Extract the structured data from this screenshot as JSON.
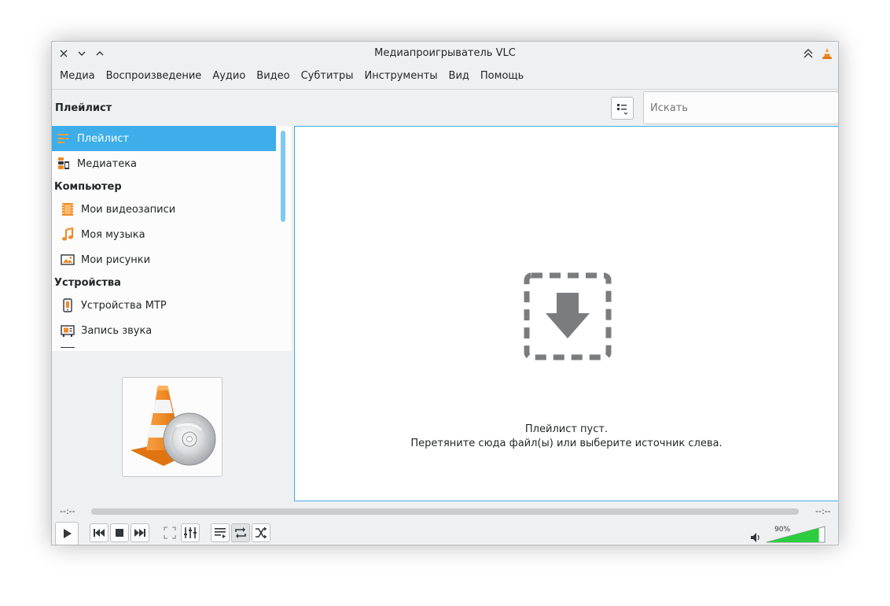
{
  "window": {
    "title": "Медиапроигрыватель VLC"
  },
  "menu": {
    "items": [
      "Медиа",
      "Воспроизведение",
      "Аудио",
      "Видео",
      "Субтитры",
      "Инструменты",
      "Вид",
      "Помощь"
    ]
  },
  "playlist_panel": {
    "header": "Плейлист",
    "search_placeholder": "Искать"
  },
  "sidebar": {
    "items": [
      {
        "label": "Плейлист",
        "icon": "playlist-icon",
        "selected": true
      },
      {
        "label": "Медиатека",
        "icon": "media-library-icon",
        "selected": false
      }
    ],
    "sections": [
      {
        "title": "Компьютер",
        "items": [
          {
            "label": "Мои видеозаписи",
            "icon": "film-icon"
          },
          {
            "label": "Моя музыка",
            "icon": "music-note-icon"
          },
          {
            "label": "Мои рисунки",
            "icon": "picture-icon"
          }
        ]
      },
      {
        "title": "Устройства",
        "items": [
          {
            "label": "Устройства MTP",
            "icon": "mtp-device-icon"
          },
          {
            "label": "Запись звука",
            "icon": "sound-capture-icon"
          }
        ]
      }
    ]
  },
  "main": {
    "empty_line1": "Плейлист пуст.",
    "empty_line2": "Перетяните сюда файл(ы) или выберите источник слева."
  },
  "controls": {
    "time_elapsed": "--:--",
    "time_total": "--:--",
    "volume_label": "90%",
    "volume_fraction": 0.9
  },
  "colors": {
    "accent": "#3daee9",
    "vlc_orange": "#f08a24",
    "volume_green": "#2ecc40",
    "window_bg": "#eff0f1"
  }
}
